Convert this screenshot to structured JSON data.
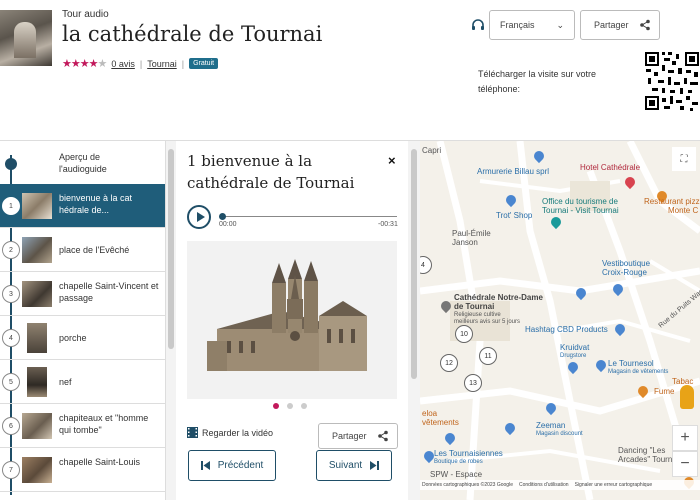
{
  "header": {
    "kicker": "Tour audio",
    "title": "la cathédrale de Tournai",
    "rating_stars": 4,
    "reviews_link": "0 avis",
    "separator": "|",
    "location_link": "Tournai",
    "badge": "Gratuit",
    "language_label": "Français",
    "share_label": "Partager",
    "download_text": "Télécharger la visite sur votre téléphone:"
  },
  "list": {
    "intro": "Aperçu de l'audioguide",
    "items": [
      {
        "num": "1",
        "label": "bienvenue à la cat hédrale de...",
        "active": true
      },
      {
        "num": "2",
        "label": "place de l'Evêché"
      },
      {
        "num": "3",
        "label": "chapelle Saint-Vincent et passage"
      },
      {
        "num": "4",
        "label": "porche"
      },
      {
        "num": "5",
        "label": "nef"
      },
      {
        "num": "6",
        "label": "chapiteaux et \"homme qui tombe\""
      },
      {
        "num": "7",
        "label": "chapelle Saint-Louis"
      }
    ]
  },
  "panel": {
    "title": "1 bienvenue à la cathédrale de Tournai",
    "close_glyph": "×",
    "time_current": "00:00",
    "time_remaining": "-00:31",
    "video_label": "Regarder la vidéo",
    "share_label": "Partager",
    "prev_label": "Précédent",
    "next_label": "Suivant",
    "progress": 0.0
  },
  "map": {
    "labels": {
      "l1": "Armurerie Billau sprl",
      "l2": "Trot' Shop",
      "l3": "Hotel Cathédrale",
      "l4": "Office du tourisme de",
      "l4b": "Tournai - Visit Tournai",
      "l5": "Restaurant pizz",
      "l5b": "Monte C",
      "l6": "Paul-Émile",
      "l6b": "Janson",
      "l7": "Vestiboutique",
      "l7b": "Croix-Rouge",
      "l8": "Cathédrale Notre-Dame",
      "l8b": "de Tournai",
      "l8c": "Religieuse cultive",
      "l8d": "meilleurs avis sur 5 jours",
      "l9": "Hashtag CBD Products",
      "l10": "Kruidvat",
      "l10b": "Drugstore",
      "l11": "Le Tournesol",
      "l11b": "Magasin de vêtements",
      "l12": "Zeeman",
      "l12b": "Magasin discount",
      "l13": "Les Tournaisiennes",
      "l13b": "Boutique de robes",
      "l14": "Dancing \"Les",
      "l14b": "Arcades\" Tournai",
      "l15": "SPW - Espace",
      "l16": "Rue du Puits Wagnor",
      "l17": "Fume",
      "l18": "Tabac",
      "l19": "eloa",
      "l20": "vêtements",
      "l21": "Capri",
      "l22": "Fume"
    },
    "circles": [
      "4",
      "10",
      "11",
      "12",
      "13"
    ],
    "zoom_in": "+",
    "zoom_out": "−",
    "attribution": [
      "Données cartographiques ©2023 Google",
      "Conditions d'utilisation",
      "Signaler une erreur cartographique"
    ]
  },
  "colors": {
    "accent": "#1f5d7a",
    "rating": "#c2185b",
    "badge": "#1f6e8c"
  }
}
